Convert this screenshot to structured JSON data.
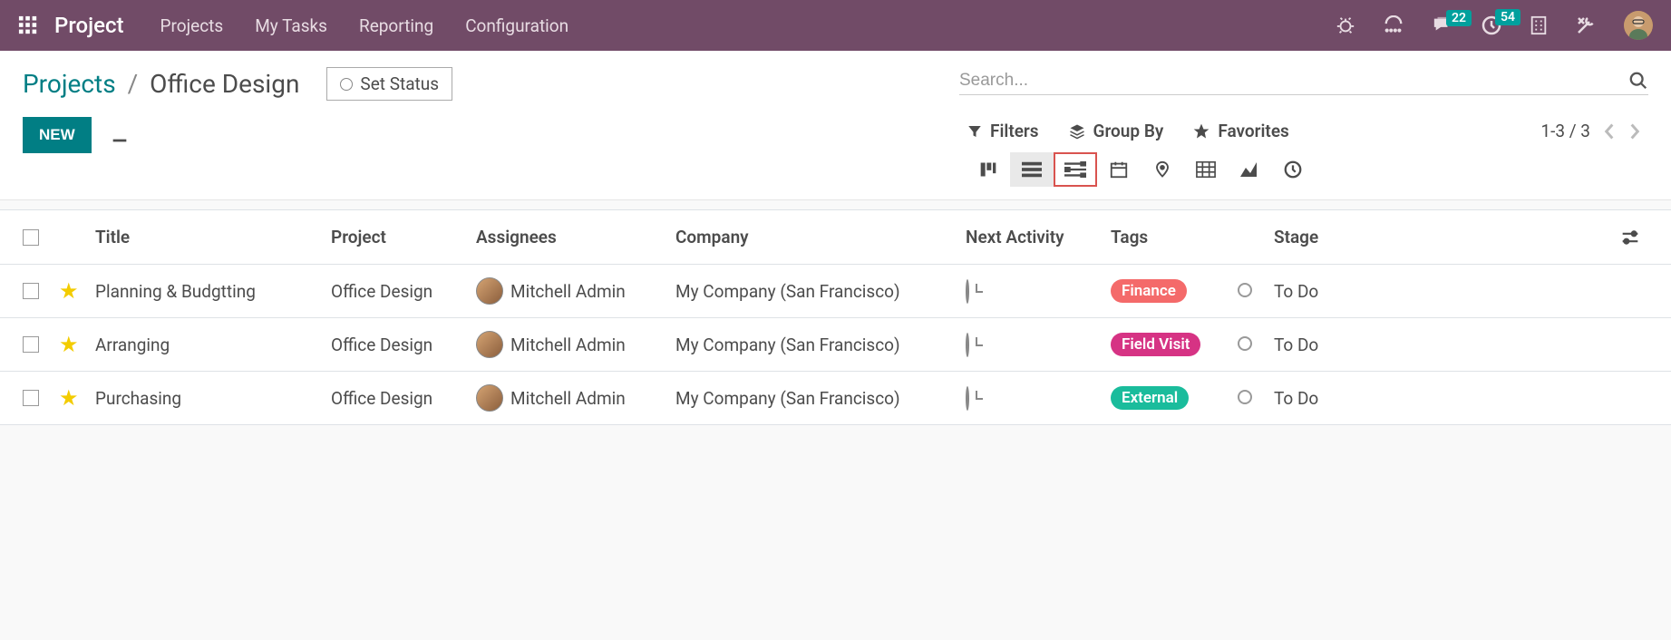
{
  "navbar": {
    "brand": "Project",
    "links": [
      "Projects",
      "My Tasks",
      "Reporting",
      "Configuration"
    ],
    "messages_badge": "22",
    "activities_badge": "54"
  },
  "breadcrumb": {
    "root": "Projects",
    "current": "Office Design"
  },
  "set_status_label": "Set Status",
  "search": {
    "placeholder": "Search..."
  },
  "new_button": "NEW",
  "filters_label": "Filters",
  "groupby_label": "Group By",
  "favorites_label": "Favorites",
  "pager": "1-3 / 3",
  "columns": {
    "title": "Title",
    "project": "Project",
    "assignees": "Assignees",
    "company": "Company",
    "next_activity": "Next Activity",
    "tags": "Tags",
    "stage": "Stage"
  },
  "rows": [
    {
      "title": "Planning & Budgtting",
      "project": "Office Design",
      "assignee": "Mitchell Admin",
      "company": "My Company (San Francisco)",
      "tag": "Finance",
      "tag_color": "#f46a6a",
      "stage": "To Do"
    },
    {
      "title": "Arranging",
      "project": "Office Design",
      "assignee": "Mitchell Admin",
      "company": "My Company (San Francisco)",
      "tag": "Field Visit",
      "tag_color": "#d63384",
      "stage": "To Do"
    },
    {
      "title": "Purchasing",
      "project": "Office Design",
      "assignee": "Mitchell Admin",
      "company": "My Company (San Francisco)",
      "tag": "External",
      "tag_color": "#1abc9c",
      "stage": "To Do"
    }
  ]
}
